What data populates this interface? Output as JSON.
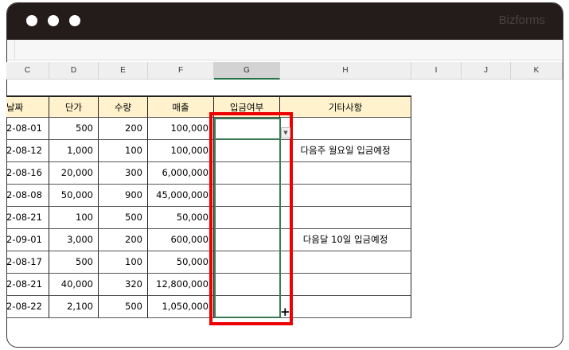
{
  "window": {
    "brand": "Bizforms"
  },
  "columns": [
    "C",
    "D",
    "E",
    "F",
    "G",
    "H",
    "I",
    "J",
    "K"
  ],
  "selected_column": "G",
  "table": {
    "headers": [
      "날짜",
      "단가",
      "수량",
      "매출",
      "입금여부",
      "기타사항"
    ],
    "rows": [
      [
        "2-08-01",
        "500",
        "200",
        "100,000",
        "",
        ""
      ],
      [
        "2-08-12",
        "1,000",
        "100",
        "100,000",
        "",
        "다음주 월요일 입금예정"
      ],
      [
        "2-08-16",
        "20,000",
        "300",
        "6,000,000",
        "",
        ""
      ],
      [
        "2-08-08",
        "50,000",
        "900",
        "45,000,000",
        "",
        ""
      ],
      [
        "2-08-21",
        "100",
        "500",
        "50,000",
        "",
        ""
      ],
      [
        "2-09-01",
        "3,000",
        "200",
        "600,000",
        "",
        "다음달 10일 입금예정"
      ],
      [
        "2-08-17",
        "500",
        "100",
        "50,000",
        "",
        ""
      ],
      [
        "2-08-21",
        "40,000",
        "320",
        "12,800,000",
        "",
        ""
      ],
      [
        "2-08-22",
        "2,100",
        "500",
        "1,050,000",
        "",
        ""
      ]
    ]
  },
  "colors": {
    "highlight": "#ee0000",
    "selection": "#3b7a57",
    "header_fill": "#fff2cc"
  }
}
